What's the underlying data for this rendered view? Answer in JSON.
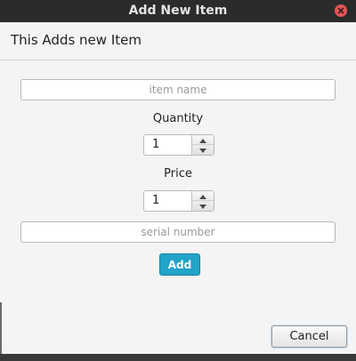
{
  "window": {
    "title": "Add New Item"
  },
  "header": {
    "text": "This Adds new Item"
  },
  "form": {
    "item_name_placeholder": "item name",
    "quantity_label": "Quantity",
    "quantity_value": "1",
    "price_label": "Price",
    "price_value": "1",
    "serial_placeholder": "serial number",
    "add_label": "Add",
    "cancel_label": "Cancel"
  },
  "icons": {
    "close": "close-icon",
    "spin_up": "arrow-up-icon",
    "spin_down": "arrow-down-icon"
  },
  "colors": {
    "titlebar": "#2b2b2b",
    "close_button": "#e05555",
    "add_button": "#22a3c8"
  }
}
